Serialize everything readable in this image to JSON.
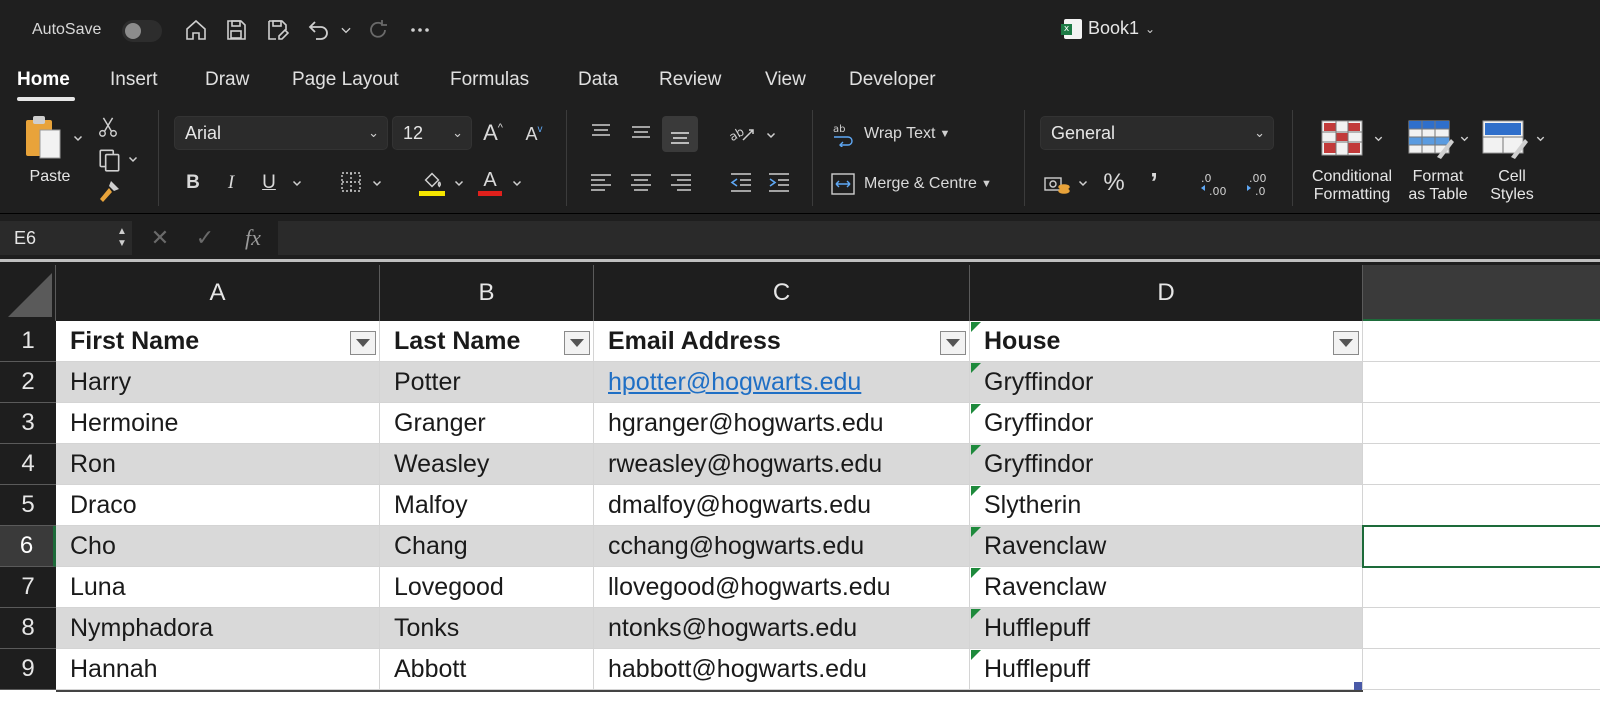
{
  "titlebar": {
    "autosave_label": "AutoSave",
    "book_title": "Book1"
  },
  "tabs": [
    "Home",
    "Insert",
    "Draw",
    "Page Layout",
    "Formulas",
    "Data",
    "Review",
    "View",
    "Developer"
  ],
  "ribbon": {
    "paste_label": "Paste",
    "font_name": "Arial",
    "font_size": "12",
    "wrap_text_label": "Wrap Text",
    "merge_label": "Merge & Centre",
    "number_format": "General",
    "conditional_formatting": [
      "Conditional",
      "Formatting"
    ],
    "format_as_table": [
      "Format",
      "as Table"
    ],
    "cell_styles": [
      "Cell",
      "Styles"
    ],
    "highlight_color": "#f5e600",
    "font_color": "#e0201c"
  },
  "formula_bar": {
    "name_box": "E6",
    "fx_label": "fx",
    "value": ""
  },
  "sheet": {
    "columns": [
      "A",
      "B",
      "C",
      "D"
    ],
    "rows": [
      "1",
      "2",
      "3",
      "4",
      "5",
      "6",
      "7",
      "8",
      "9"
    ],
    "selected_row": "6",
    "header": [
      "First Name",
      "Last Name",
      "Email Address",
      "House"
    ],
    "data": [
      [
        "Harry",
        "Potter",
        "hpotter@hogwarts.edu",
        "Gryffindor"
      ],
      [
        "Hermoine",
        "Granger",
        "hgranger@hogwarts.edu",
        "Gryffindor"
      ],
      [
        "Ron",
        "Weasley",
        "rweasley@hogwarts.edu",
        "Gryffindor"
      ],
      [
        "Draco",
        "Malfoy",
        "dmalfoy@hogwarts.edu",
        "Slytherin"
      ],
      [
        "Cho",
        "Chang",
        "cchang@hogwarts.edu",
        "Ravenclaw"
      ],
      [
        "Luna",
        "Lovegood",
        "llovegood@hogwarts.edu",
        "Ravenclaw"
      ],
      [
        "Nymphadora",
        "Tonks",
        "ntonks@hogwarts.edu",
        "Hufflepuff"
      ],
      [
        "Hannah",
        "Abbott",
        "habbott@hogwarts.edu",
        "Hufflepuff"
      ]
    ]
  }
}
